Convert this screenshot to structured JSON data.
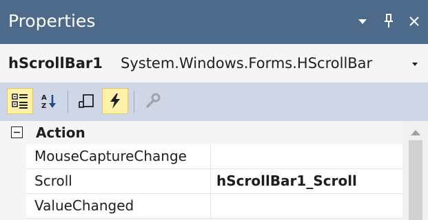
{
  "titlebar": {
    "title": "Properties",
    "dropdown_icon": "dropdown-arrow-icon",
    "pin_icon": "pin-icon",
    "close_icon": "close-icon"
  },
  "object_selector": {
    "name": "hScrollBar1",
    "type": "System.Windows.Forms.HScrollBar",
    "dropdown_icon": "chevron-down-icon"
  },
  "toolbar": {
    "buttons": [
      {
        "name": "categorized",
        "icon": "categorized-icon",
        "active": true
      },
      {
        "name": "alphabetical",
        "icon": "alphabetical-sort-icon",
        "active": false
      },
      {
        "name": "properties",
        "icon": "properties-icon",
        "active": false
      },
      {
        "name": "events",
        "icon": "lightning-icon",
        "active": true
      },
      {
        "name": "property-pages",
        "icon": "wrench-icon",
        "active": false
      }
    ]
  },
  "grid": {
    "category": {
      "label": "Action",
      "toggle": "−"
    },
    "rows": [
      {
        "name": "MouseCaptureChange",
        "value": ""
      },
      {
        "name": "Scroll",
        "value": "hScrollBar1_Scroll"
      },
      {
        "name": "ValueChanged",
        "value": ""
      }
    ]
  },
  "colors": {
    "titlebar": "#4e6a8a",
    "toolbar": "#cfd6e5",
    "active_button": "#fdf1a9"
  }
}
